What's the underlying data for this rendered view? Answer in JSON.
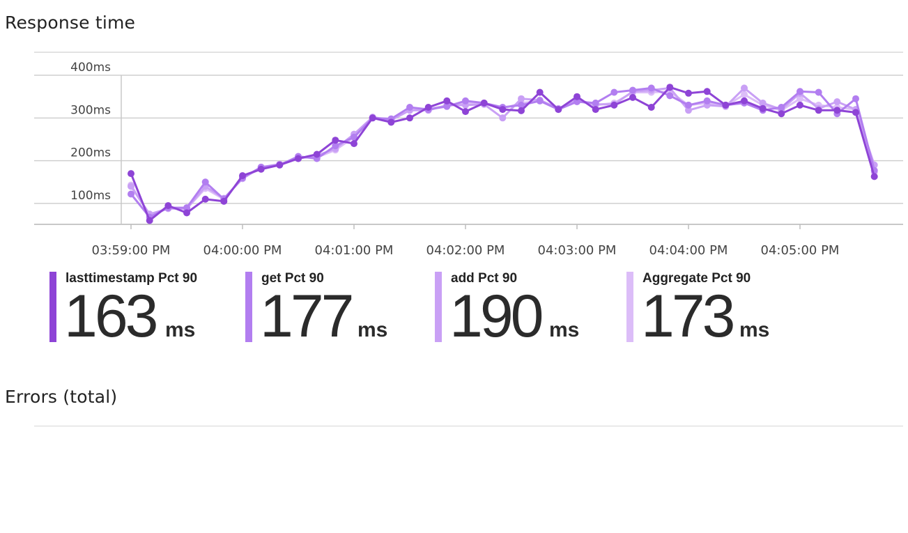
{
  "response_section": {
    "title": "Response time"
  },
  "errors_section": {
    "title": "Errors (total)"
  },
  "chart_data": {
    "type": "line",
    "title": "Response time",
    "y_ticks": [
      "100ms",
      "200ms",
      "300ms",
      "400ms"
    ],
    "y_tick_values": [
      100,
      200,
      300,
      400
    ],
    "ylim": [
      50,
      450
    ],
    "x_tick_labels": [
      "03:59:00 PM",
      "04:00:00 PM",
      "04:01:00 PM",
      "04:02:00 PM",
      "04:03:00 PM",
      "04:04:00 PM",
      "04:05:00 PM"
    ],
    "x_tick_seconds": [
      0,
      60,
      120,
      180,
      240,
      300,
      360
    ],
    "xlim": [
      -5,
      415
    ],
    "x_seconds": [
      0,
      10,
      20,
      30,
      40,
      50,
      60,
      70,
      80,
      90,
      100,
      110,
      120,
      130,
      140,
      150,
      160,
      170,
      180,
      190,
      200,
      210,
      220,
      230,
      240,
      250,
      260,
      270,
      280,
      290,
      300,
      310,
      320,
      330,
      340,
      350,
      360,
      370,
      380,
      390,
      400
    ],
    "grid": true,
    "legend_placement": "bottom",
    "series": [
      {
        "name": "lasttimestamp Pct 90",
        "color": "#8e44d6",
        "values": [
          170,
          60,
          95,
          78,
          110,
          105,
          165,
          180,
          190,
          205,
          215,
          248,
          240,
          300,
          290,
          300,
          325,
          340,
          315,
          335,
          320,
          317,
          360,
          320,
          350,
          320,
          330,
          348,
          325,
          372,
          358,
          362,
          330,
          340,
          322,
          310,
          330,
          318,
          318,
          313,
          163
        ]
      },
      {
        "name": "get Pct 90",
        "color": "#b27ef0",
        "values": [
          122,
          68,
          90,
          90,
          150,
          110,
          160,
          185,
          190,
          210,
          205,
          235,
          255,
          300,
          298,
          325,
          320,
          327,
          340,
          335,
          325,
          330,
          340,
          320,
          338,
          335,
          360,
          365,
          370,
          352,
          330,
          340,
          330,
          335,
          318,
          325,
          362,
          360,
          310,
          345,
          177
        ]
      },
      {
        "name": "add Pct 90",
        "color": "#c9a0f5",
        "values": [
          140,
          75,
          88,
          88,
          140,
          112,
          158,
          185,
          192,
          205,
          212,
          228,
          262,
          302,
          295,
          318,
          318,
          330,
          330,
          332,
          300,
          345,
          342,
          322,
          342,
          332,
          332,
          362,
          365,
          370,
          318,
          330,
          327,
          370,
          335,
          320,
          358,
          322,
          338,
          320,
          190
        ]
      },
      {
        "name": "Aggregate Pct 90",
        "color": "#dcbdf8",
        "values": [
          143,
          72,
          90,
          88,
          135,
          110,
          160,
          182,
          190,
          207,
          208,
          225,
          255,
          300,
          295,
          318,
          322,
          328,
          335,
          335,
          322,
          335,
          340,
          320,
          340,
          330,
          335,
          360,
          360,
          362,
          330,
          335,
          328,
          355,
          330,
          318,
          345,
          330,
          325,
          320,
          173
        ]
      }
    ]
  },
  "legend": [
    {
      "label": "lasttimestamp Pct 90",
      "value": "163",
      "unit": "ms",
      "color": "#8e44d6"
    },
    {
      "label": "get Pct 90",
      "value": "177",
      "unit": "ms",
      "color": "#b27ef0"
    },
    {
      "label": "add Pct 90",
      "value": "190",
      "unit": "ms",
      "color": "#c9a0f5"
    },
    {
      "label": "Aggregate Pct 90",
      "value": "173",
      "unit": "ms",
      "color": "#dcbdf8"
    }
  ]
}
